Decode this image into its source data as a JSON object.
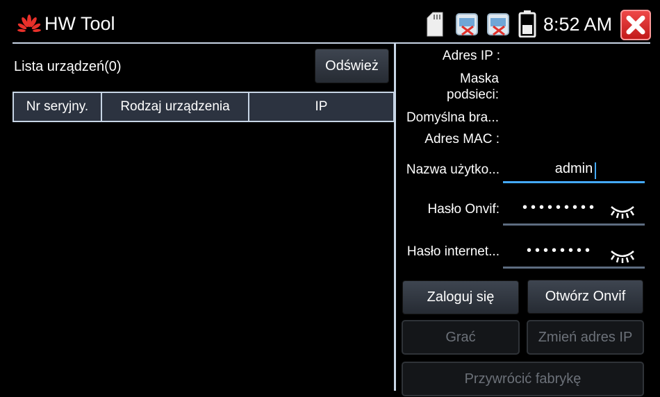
{
  "header": {
    "app_title": "HW Tool",
    "clock": "8:52 AM",
    "icons": [
      "huawei-logo",
      "sd-card-icon",
      "camera-disconnected-icon",
      "camera-disconnected-icon",
      "battery-icon",
      "close-icon"
    ],
    "close_color": "#e02a2a"
  },
  "device_list": {
    "title": "Lista urządzeń(0)",
    "refresh_label": "Odśwież",
    "columns": [
      "Nr seryjny.",
      "Rodzaj urządzenia",
      "IP"
    ],
    "rows": []
  },
  "details": {
    "ip_label": "Adres IP :",
    "mask_label_line1": "Maska",
    "mask_label_line2": "podsieci:",
    "gateway_label": "Domyślna bra...",
    "mac_label": "Adres MAC :",
    "username_label": "Nazwa użytko...",
    "username_value": "admin",
    "onvif_password_label": "Hasło Onvif:",
    "onvif_password_value": "•••••••••",
    "web_password_label": "Hasło internet...",
    "web_password_value": "••••••••"
  },
  "actions": {
    "login": "Zaloguj się",
    "open_onvif": "Otwórz Onvif",
    "play": "Grać",
    "change_ip": "Zmień adres IP",
    "factory_reset": "Przywrócić fabrykę"
  },
  "colors": {
    "accent": "#44aaff",
    "border": "#c8d6e6",
    "disabled_text": "#6c7179"
  }
}
